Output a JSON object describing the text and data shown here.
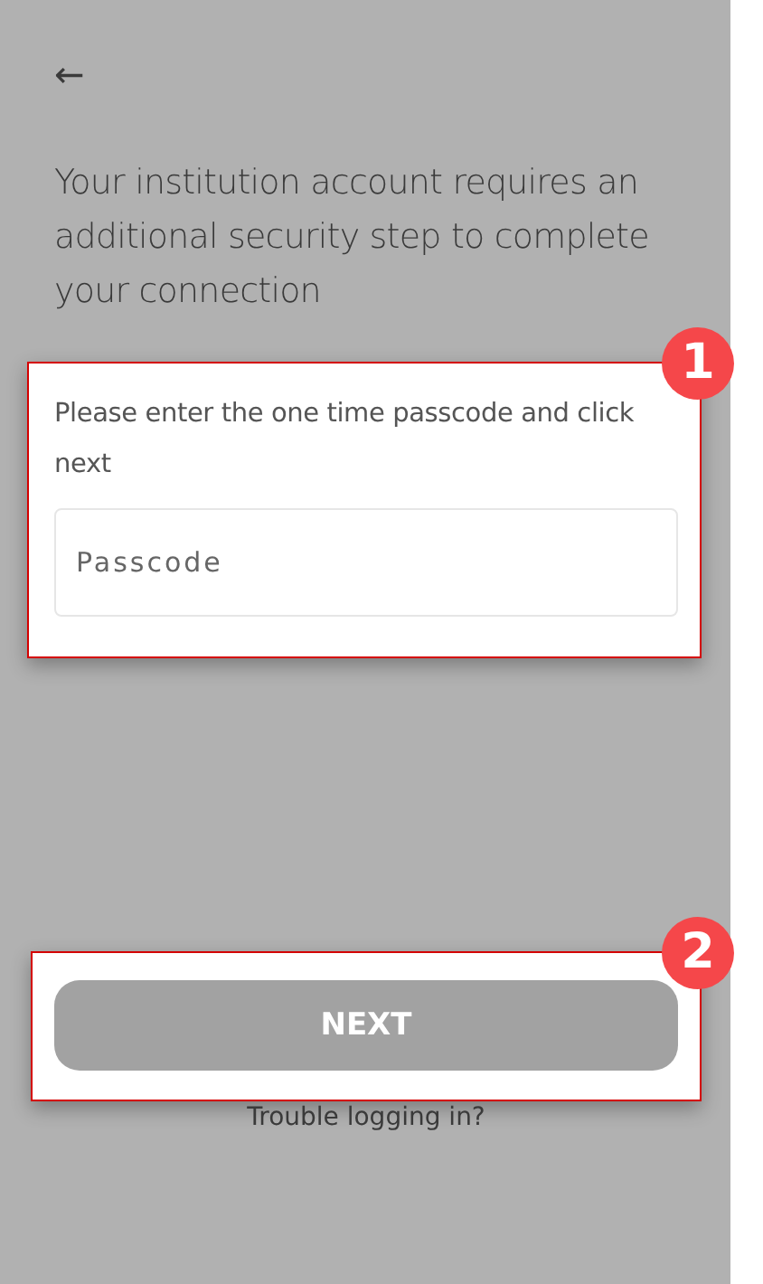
{
  "back_button": {
    "label": "←"
  },
  "heading": "Your institution account requires an additional security step to complete your connection",
  "passcode_panel": {
    "badge": "1",
    "instruction": "Please enter the one time passcode and click next",
    "passcode_field": {
      "placeholder": "Passcode"
    }
  },
  "action_panel": {
    "badge": "2",
    "next_button": {
      "label": "NEXT",
      "disabled": true
    },
    "help_link": "Trouble logging in?"
  }
}
